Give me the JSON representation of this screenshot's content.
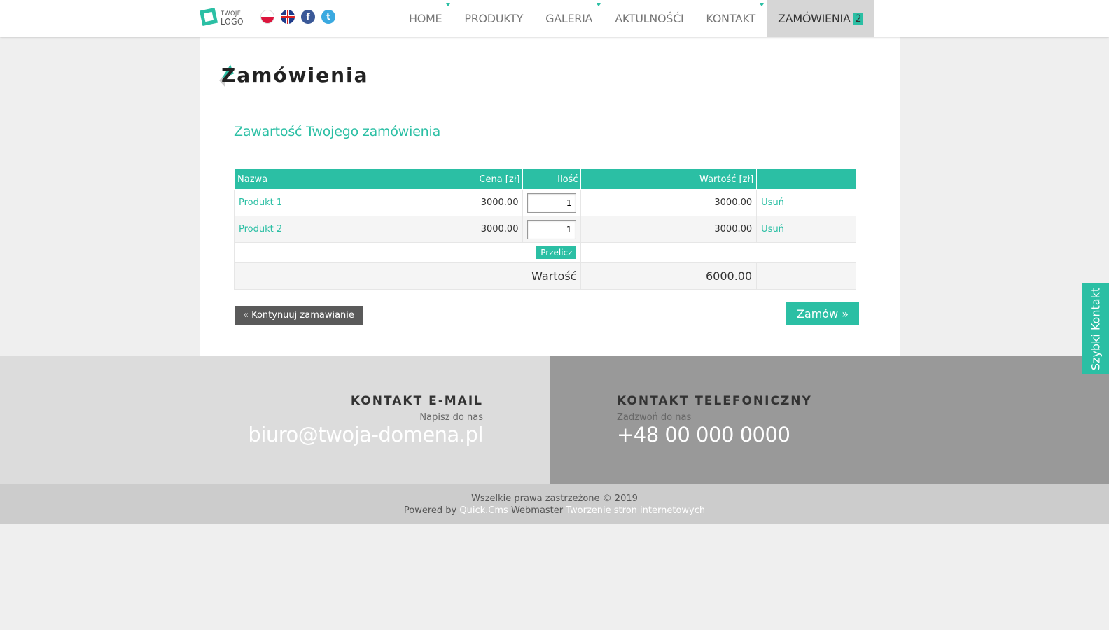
{
  "header": {
    "logo": {
      "line1": "TWOJE",
      "line2": "LOGO"
    },
    "social": [
      {
        "name": "polish-flag-icon"
      },
      {
        "name": "uk-flag-icon"
      },
      {
        "name": "facebook-icon",
        "glyph": "f"
      },
      {
        "name": "twitter-icon",
        "glyph": "t"
      }
    ],
    "nav": [
      {
        "label": "HOME",
        "has_submenu": true
      },
      {
        "label": "PRODUKTY",
        "has_submenu": false
      },
      {
        "label": "GALERIA",
        "has_submenu": true
      },
      {
        "label": "AKTULNOŚĆI",
        "has_submenu": false
      },
      {
        "label": "KONTAKT",
        "has_submenu": true
      },
      {
        "label": "ZAMÓWIENIA",
        "badge": "2",
        "active": true
      }
    ]
  },
  "main": {
    "title": "Zamówienia",
    "subtitle": "Zawartość Twojego zamówienia",
    "table": {
      "headers": [
        "Nazwa",
        "Cena [zł]",
        "Ilość",
        "Wartość [zł]",
        ""
      ],
      "rows": [
        {
          "name": "Produkt 1",
          "price": "3000.00",
          "qty": "1",
          "value": "3000.00",
          "remove": "Usuń"
        },
        {
          "name": "Produkt 2",
          "price": "3000.00",
          "qty": "1",
          "value": "3000.00",
          "remove": "Usuń"
        }
      ],
      "recalc_label": "Przelicz",
      "total_label": "Wartość",
      "total_value": "6000.00"
    },
    "continue_label": "« Kontynuuj zamawianie",
    "order_label": "Zamów »"
  },
  "footer": {
    "email": {
      "title": "KONTAKT E-MAIL",
      "sub": "Napisz do nas",
      "value": "biuro@twoja-domena.pl"
    },
    "phone": {
      "title": "KONTAKT TELEFONICZNY",
      "sub": "Zadzwoń do nas",
      "value": "+48 00 000 0000"
    },
    "copyright": "Wszelkie prawa zastrzeżone © 2019",
    "powered_by": "Powered by",
    "quickcms": "Quick.Cms",
    "webmaster": "Webmaster",
    "tworzenie": "Tworzenie stron internetowych"
  },
  "side_tab": "Szybki Kontakt",
  "colors": {
    "accent": "#2bbfa4",
    "dark_button": "#5a5a5a"
  }
}
